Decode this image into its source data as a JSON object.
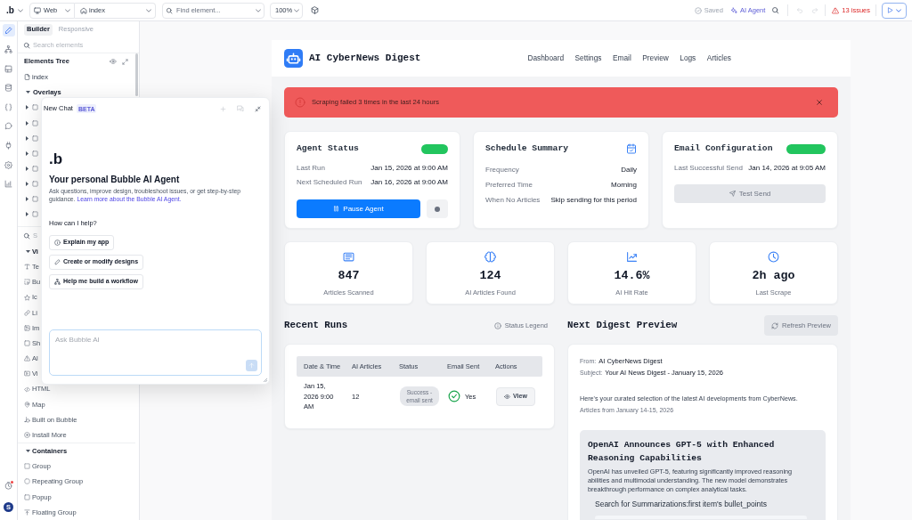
{
  "top_bar": {
    "logo": ".b",
    "platform": "Web",
    "page": "index",
    "find_element": {
      "placeholder": "Find element..."
    },
    "zoom": "100%",
    "saved": "Saved",
    "ai_agent": "AI Agent",
    "undo": {
      "disabled": true
    },
    "redo": {
      "disabled": true
    },
    "issues": "13 issues"
  },
  "icon_rail": {
    "items": [
      {
        "selected": true
      },
      {
        "selected": false
      },
      {
        "selected": false
      },
      {
        "selected": false
      },
      {
        "selected": false
      },
      {
        "selected": false
      },
      {
        "selected": false
      },
      {
        "selected": false
      },
      {
        "selected": false
      }
    ],
    "alerts": {
      "unread": true
    },
    "avatar": "S"
  },
  "left_panel": {
    "tabs": [
      {
        "label": "Builder",
        "selected": true
      },
      {
        "label": "Responsive",
        "selected": false
      }
    ],
    "search": {
      "placeholder": "Search elements"
    },
    "tree_title": "Elements Tree",
    "tree": [
      {
        "label": "index"
      },
      {
        "label": "Overlays",
        "expanded": true,
        "children": [
          {
            "expanded": false
          },
          {
            "expanded": false
          },
          {
            "expanded": false
          },
          {
            "expanded": false
          },
          {
            "expanded": false
          },
          {
            "expanded": false
          },
          {
            "expanded": false
          },
          {
            "expanded": false
          }
        ]
      }
    ],
    "element_search": {
      "placeholder": "S"
    },
    "sections": [
      {
        "label": "Vi",
        "expanded": true,
        "items": [
          "Te",
          "Bu",
          "Ic",
          "Li",
          "Im",
          "Sh",
          "Al",
          "Vi",
          "HTML",
          "Map",
          "Built on Bubble",
          "Install More"
        ]
      },
      {
        "label": "Containers",
        "expanded": true,
        "items": [
          "Group",
          "Repeating Group",
          "Popup",
          "Floating Group"
        ]
      }
    ]
  },
  "chat_panel": {
    "title": "New Chat",
    "badge": "BETA",
    "logo": ".b",
    "heading": "Your personal Bubble AI Agent",
    "description": "Ask questions, improve design, troubleshoot issues, or get step-by-step guidance.",
    "link": "Learn more about the Bubble AI Agent.",
    "prompt": "How can I help?",
    "suggestions": [
      "Explain my app",
      "Create or modify designs",
      "Help me build a workflow"
    ],
    "input": {
      "placeholder": "Ask Bubble AI"
    }
  },
  "page": {
    "app_title": "AI CyberNews Digest",
    "nav": [
      "Dashboard",
      "Settings",
      "Email",
      "Preview",
      "Logs",
      "Articles"
    ],
    "alert": {
      "message": "Scraping failed 3 times in the last 24 hours"
    },
    "agent_status": {
      "title": "Agent Status",
      "active": true,
      "rows": [
        {
          "label": "Last Run",
          "value": "Jan 15, 2026 at 9:00 AM"
        },
        {
          "label": "Next Scheduled Run",
          "value": "Jan 16, 2026 at 9:00 AM"
        }
      ],
      "button": "Pause Agent"
    },
    "schedule_summary": {
      "title": "Schedule Summary",
      "rows": [
        {
          "label": "Frequency",
          "value": "Daily"
        },
        {
          "label": "Preferred Time",
          "value": "Morning"
        },
        {
          "label": "When No Articles",
          "value": "Skip sending for this period"
        }
      ]
    },
    "email_configuration": {
      "title": "Email Configuration",
      "active": true,
      "rows": [
        {
          "label": "Last Successful Send",
          "value": "Jan 14, 2026 at 9:05 AM"
        }
      ],
      "button": "Test Send"
    },
    "stats": [
      {
        "value": "847",
        "label": "Articles Scanned"
      },
      {
        "value": "124",
        "label": "AI Articles Found"
      },
      {
        "value": "14.6%",
        "label": "AI Hit Rate"
      },
      {
        "value": "2h ago",
        "label": "Last Scrape"
      }
    ],
    "recent_runs": {
      "title": "Recent Runs",
      "legend": "Status Legend",
      "columns": [
        "Date & Time",
        "AI Articles",
        "Status",
        "Email Sent",
        "Actions"
      ],
      "rows": [
        {
          "date_time": "Jan 15, 2026 9:00 AM",
          "ai_articles": "12",
          "status": "Success - email sent",
          "email_sent": "Yes",
          "action": "View"
        }
      ]
    },
    "digest_preview": {
      "title": "Next Digest Preview",
      "refresh": "Refresh Preview",
      "from_label": "From:",
      "from": "AI CyberNews Digest",
      "subject_label": "Subject:",
      "subject": "Your AI News Digest - January 15, 2026",
      "intro": "Here's your curated selection of the latest AI developments from CyberNews.",
      "range": "Articles from January 14-15, 2026",
      "articles": [
        {
          "title": "OpenAI Announces GPT-5 with Enhanced Reasoning Capabilities",
          "summary": "OpenAI has unveiled GPT-5, featuring significantly improved reasoning abilities and multimodal understanding. The new model demonstrates breakthrough performance on complex analytical tasks.",
          "bullets": "Search for Summarizations:first item's bullet_points"
        }
      ]
    }
  }
}
